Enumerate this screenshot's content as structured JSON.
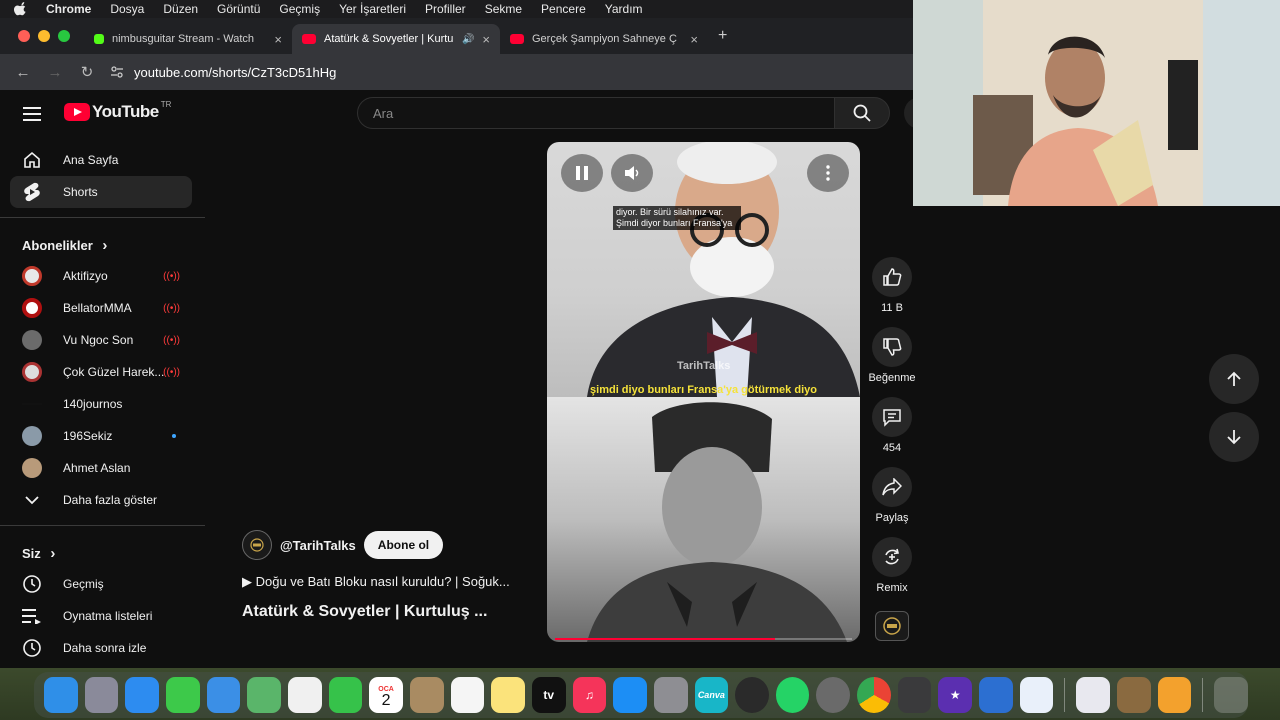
{
  "menubar": {
    "app": "Chrome",
    "items": [
      "Dosya",
      "Düzen",
      "Görüntü",
      "Geçmiş",
      "Yer İşaretleri",
      "Profiller",
      "Sekme",
      "Pencere",
      "Yardım"
    ]
  },
  "tabs": [
    {
      "title": "nimbusguitar Stream - Watch",
      "close": "×"
    },
    {
      "title": "Atatürk & Sovyetler | Kurtu",
      "close": "×",
      "audio": "🔊"
    },
    {
      "title": "Gerçek Şampiyon Sahneye Ç",
      "close": "×"
    }
  ],
  "newtab": "+",
  "address": {
    "url": "youtube.com/shorts/CzT3cD51hHg"
  },
  "youtube": {
    "logo_word": "YouTube",
    "country": "TR",
    "search_placeholder": "Ara",
    "nav": [
      {
        "label": "Ana Sayfa"
      },
      {
        "label": "Shorts"
      }
    ],
    "subs_heading": "Abonelikler",
    "subs_chevron": "›",
    "subscriptions": [
      {
        "label": "Aktifizyo",
        "status": "live"
      },
      {
        "label": "BellatorMMA",
        "status": "live"
      },
      {
        "label": "Vu Ngoc Son",
        "status": "live"
      },
      {
        "label": "Çok Güzel Harek...",
        "status": "live"
      },
      {
        "label": "140journos",
        "status": "none"
      },
      {
        "label": "196Sekiz",
        "status": "new"
      },
      {
        "label": "Ahmet Aslan",
        "status": "none"
      }
    ],
    "more_label": "Daha fazla göster",
    "you_heading": "Siz",
    "you_items": [
      {
        "label": "Geçmiş"
      },
      {
        "label": "Oynatma listeleri"
      },
      {
        "label": "Daha sonra izle"
      }
    ]
  },
  "short": {
    "caption_top": "diyor. Bir sürü silahınız var. Şimdi diyor bunları Fransa'ya",
    "caption_yellow": "şimdi diyo bunları Fransa'ya götürmek diyo",
    "watermark": "TarihTalks",
    "progress": 0.74,
    "channel_handle": "@TarihTalks",
    "subscribe_label": "Abone ol",
    "playlist_line": "▶ Doğu ve Batı Bloku nasıl kuruldu? | Soğuk...",
    "title": "Atatürk & Sovyetler | Kurtuluş ...",
    "actions": [
      {
        "name": "like",
        "label": "11 B"
      },
      {
        "name": "dislike",
        "label": "Beğenme"
      },
      {
        "name": "comments",
        "label": "454"
      },
      {
        "name": "share",
        "label": "Paylaş"
      },
      {
        "name": "remix",
        "label": "Remix"
      }
    ]
  },
  "dock": {
    "calendar_month": "OCA",
    "calendar_day": "2",
    "tv_label": "tv",
    "canva_label": "Canva"
  },
  "colors": {
    "youtube_red": "#ff0033",
    "live_red": "#ff3b3b",
    "new_dot": "#3ea6ff",
    "background": "#0f0f0f"
  }
}
